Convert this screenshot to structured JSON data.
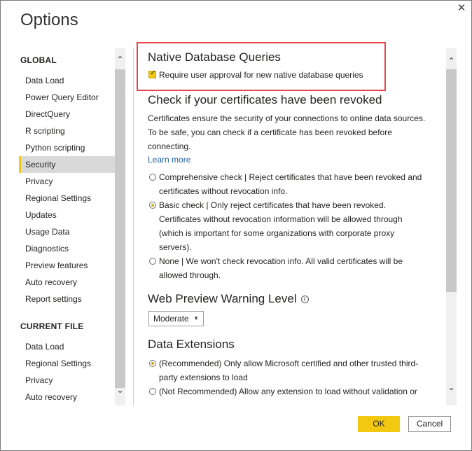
{
  "window": {
    "title": "Options",
    "close_icon": "close-icon",
    "close_glyph": "✕"
  },
  "sidebar": {
    "global_header": "GLOBAL",
    "global_items": [
      {
        "label": "Data Load"
      },
      {
        "label": "Power Query Editor"
      },
      {
        "label": "DirectQuery"
      },
      {
        "label": "R scripting"
      },
      {
        "label": "Python scripting"
      },
      {
        "label": "Security",
        "active": true
      },
      {
        "label": "Privacy"
      },
      {
        "label": "Regional Settings"
      },
      {
        "label": "Updates"
      },
      {
        "label": "Usage Data"
      },
      {
        "label": "Diagnostics"
      },
      {
        "label": "Preview features"
      },
      {
        "label": "Auto recovery"
      },
      {
        "label": "Report settings"
      }
    ],
    "current_header": "CURRENT FILE",
    "current_items": [
      {
        "label": "Data Load"
      },
      {
        "label": "Regional Settings"
      },
      {
        "label": "Privacy"
      },
      {
        "label": "Auto recovery"
      }
    ],
    "scroll_up_glyph": "⌃",
    "scroll_down_glyph": "⌄"
  },
  "main": {
    "native": {
      "heading": "Native Database Queries",
      "checkbox_label": "Require user approval for new native database queries",
      "checked": true,
      "check_glyph": "✓"
    },
    "certs": {
      "heading": "Check if your certificates have been revoked",
      "description": "Certificates ensure the security of your connections to online data sources. To be safe, you can check if a certificate has been revoked before connecting.",
      "learn_more": "Learn more",
      "options": [
        {
          "label": "Comprehensive check | Reject certificates that have been revoked and certificates without revocation info.",
          "selected": false
        },
        {
          "label": "Basic check | Only reject certificates that have been revoked. Certificates without revocation information will be allowed through (which is important for some organizations with corporate proxy servers).",
          "selected": true
        },
        {
          "label": "None | We won't check revocation info. All valid certificates will be allowed through.",
          "selected": false
        }
      ]
    },
    "web_preview": {
      "heading": "Web Preview Warning Level",
      "info_glyph": "i",
      "selected_value": "Moderate",
      "caret_glyph": "▼"
    },
    "extensions": {
      "heading": "Data Extensions",
      "options": [
        {
          "label": "(Recommended) Only allow Microsoft certified and other trusted third-party extensions to load",
          "selected": true
        },
        {
          "label": "(Not Recommended) Allow any extension to load without validation or",
          "selected": false
        }
      ]
    }
  },
  "footer": {
    "ok_label": "OK",
    "cancel_label": "Cancel"
  },
  "colors": {
    "accent": "#f2c811",
    "highlight_box": "#e5484d",
    "link": "#1f5fa3"
  }
}
